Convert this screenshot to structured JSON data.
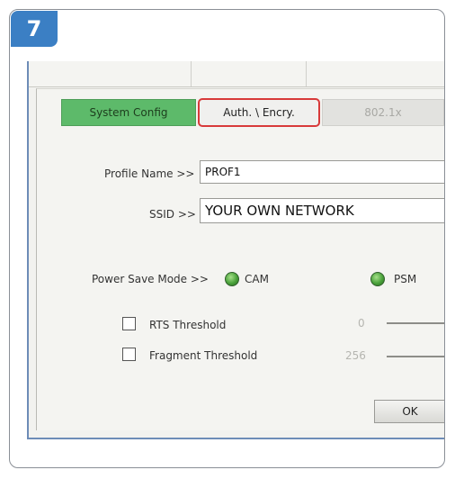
{
  "step": {
    "number": "7"
  },
  "tabs": {
    "system_config": "System Config",
    "auth_encry": "Auth. \\ Encry.",
    "dot1x": "802.1x"
  },
  "profile": {
    "name_label": "Profile Name >>",
    "name_value": "PROF1",
    "ssid_label": "SSID >>",
    "ssid_value": "YOUR OWN NETWORK"
  },
  "power_save": {
    "label": "Power Save Mode >>",
    "options": [
      "CAM",
      "PSM"
    ]
  },
  "thresholds": {
    "rts_label": "RTS Threshold",
    "rts_value": "0",
    "fragment_label": "Fragment Threshold",
    "fragment_value": "256"
  },
  "buttons": {
    "ok": "OK"
  },
  "colors": {
    "badge": "#3b7fc4",
    "active_tab": "#5dba6a",
    "highlight_border": "#d83a3a"
  }
}
